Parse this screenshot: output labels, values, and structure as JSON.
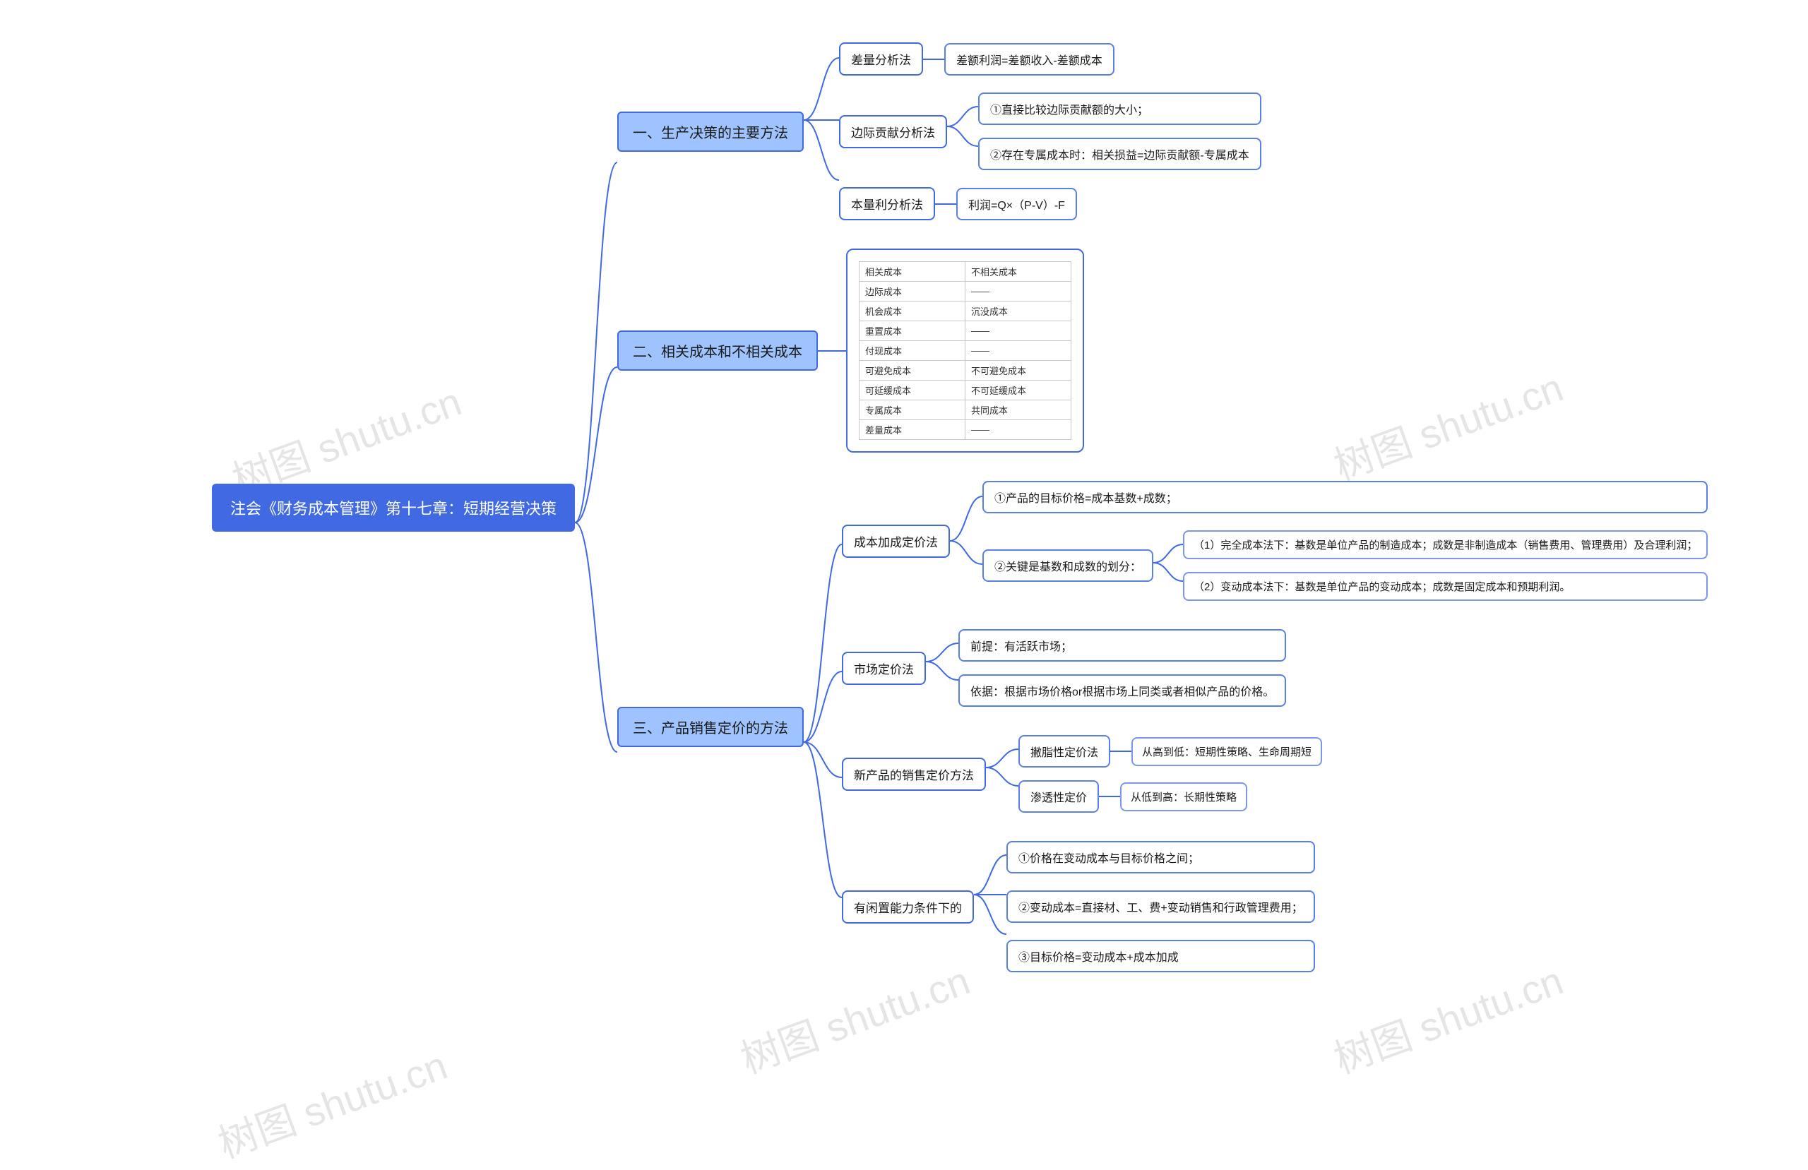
{
  "watermark": "树图 shutu.cn",
  "root": "注会《财务成本管理》第十七章：短期经营决策",
  "b1": {
    "title": "一、生产决策的主要方法",
    "c1": {
      "label": "差量分析法",
      "d1": "差额利润=差额收入-差额成本"
    },
    "c2": {
      "label": "边际贡献分析法",
      "d1": "①直接比较边际贡献额的大小；",
      "d2": "②存在专属成本时：相关损益=边际贡献额-专属成本"
    },
    "c3": {
      "label": "本量利分析法",
      "d1": "利润=Q×（P-V）-F"
    }
  },
  "b2": {
    "title": "二、相关成本和不相关成本",
    "table": {
      "header": [
        "相关成本",
        "不相关成本"
      ],
      "rows": [
        [
          "边际成本",
          "——"
        ],
        [
          "机会成本",
          "沉没成本"
        ],
        [
          "重置成本",
          "——"
        ],
        [
          "付现成本",
          "——"
        ],
        [
          "可避免成本",
          "不可避免成本"
        ],
        [
          "可延缓成本",
          "不可延缓成本"
        ],
        [
          "专属成本",
          "共同成本"
        ],
        [
          "差量成本",
          "——"
        ]
      ]
    }
  },
  "b3": {
    "title": "三、产品销售定价的方法",
    "c1": {
      "label": "成本加成定价法",
      "d1": "①产品的目标价格=成本基数+成数；",
      "d2": {
        "label": "②关键是基数和成数的划分：",
        "e1": "（1）完全成本法下：基数是单位产品的制造成本；成数是非制造成本（销售费用、管理费用）及合理利润；",
        "e2": "（2）变动成本法下：基数是单位产品的变动成本；成数是固定成本和预期利润。"
      }
    },
    "c2": {
      "label": "市场定价法",
      "d1": "前提：有活跃市场；",
      "d2": "依据：根据市场价格or根据市场上同类或者相似产品的价格。"
    },
    "c3": {
      "label": "新产品的销售定价方法",
      "d1": {
        "label": "撇脂性定价法",
        "e1": "从高到低：短期性策略、生命周期短"
      },
      "d2": {
        "label": "渗透性定价",
        "e1": "从低到高：长期性策略"
      }
    },
    "c4": {
      "label": "有闲置能力条件下的",
      "d1": "①价格在变动成本与目标价格之间；",
      "d2": "②变动成本=直接材、工、费+变动销售和行政管理费用；",
      "d3": "③目标价格=变动成本+成本加成"
    }
  }
}
